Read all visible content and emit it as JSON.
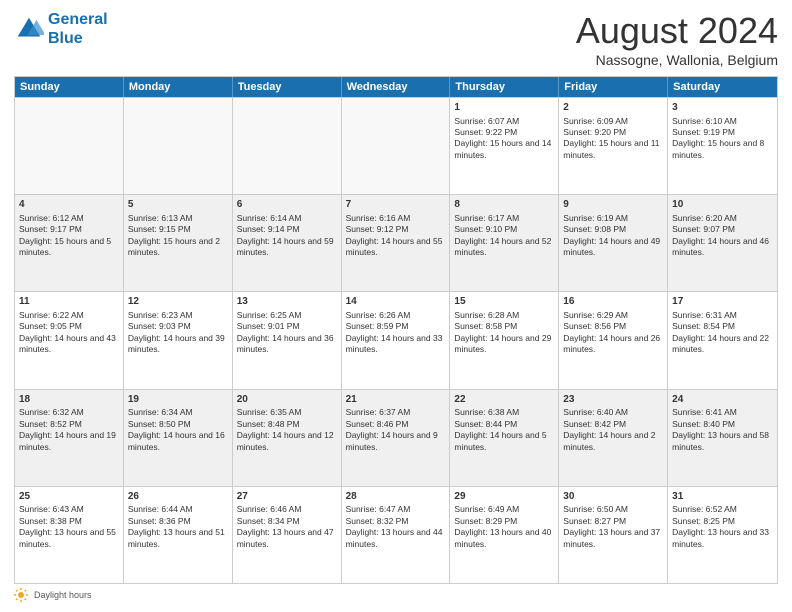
{
  "header": {
    "logo_line1": "General",
    "logo_line2": "Blue",
    "month_title": "August 2024",
    "subtitle": "Nassogne, Wallonia, Belgium"
  },
  "weekdays": [
    "Sunday",
    "Monday",
    "Tuesday",
    "Wednesday",
    "Thursday",
    "Friday",
    "Saturday"
  ],
  "footer": {
    "note": "Daylight hours"
  },
  "weeks": [
    [
      {
        "day": "",
        "empty": true
      },
      {
        "day": "",
        "empty": true
      },
      {
        "day": "",
        "empty": true
      },
      {
        "day": "",
        "empty": true
      },
      {
        "day": "1",
        "rise": "Sunrise: 6:07 AM",
        "set": "Sunset: 9:22 PM",
        "daylight": "Daylight: 15 hours and 14 minutes."
      },
      {
        "day": "2",
        "rise": "Sunrise: 6:09 AM",
        "set": "Sunset: 9:20 PM",
        "daylight": "Daylight: 15 hours and 11 minutes."
      },
      {
        "day": "3",
        "rise": "Sunrise: 6:10 AM",
        "set": "Sunset: 9:19 PM",
        "daylight": "Daylight: 15 hours and 8 minutes."
      }
    ],
    [
      {
        "day": "4",
        "rise": "Sunrise: 6:12 AM",
        "set": "Sunset: 9:17 PM",
        "daylight": "Daylight: 15 hours and 5 minutes.",
        "shaded": true
      },
      {
        "day": "5",
        "rise": "Sunrise: 6:13 AM",
        "set": "Sunset: 9:15 PM",
        "daylight": "Daylight: 15 hours and 2 minutes.",
        "shaded": true
      },
      {
        "day": "6",
        "rise": "Sunrise: 6:14 AM",
        "set": "Sunset: 9:14 PM",
        "daylight": "Daylight: 14 hours and 59 minutes.",
        "shaded": true
      },
      {
        "day": "7",
        "rise": "Sunrise: 6:16 AM",
        "set": "Sunset: 9:12 PM",
        "daylight": "Daylight: 14 hours and 55 minutes.",
        "shaded": true
      },
      {
        "day": "8",
        "rise": "Sunrise: 6:17 AM",
        "set": "Sunset: 9:10 PM",
        "daylight": "Daylight: 14 hours and 52 minutes.",
        "shaded": true
      },
      {
        "day": "9",
        "rise": "Sunrise: 6:19 AM",
        "set": "Sunset: 9:08 PM",
        "daylight": "Daylight: 14 hours and 49 minutes.",
        "shaded": true
      },
      {
        "day": "10",
        "rise": "Sunrise: 6:20 AM",
        "set": "Sunset: 9:07 PM",
        "daylight": "Daylight: 14 hours and 46 minutes.",
        "shaded": true
      }
    ],
    [
      {
        "day": "11",
        "rise": "Sunrise: 6:22 AM",
        "set": "Sunset: 9:05 PM",
        "daylight": "Daylight: 14 hours and 43 minutes."
      },
      {
        "day": "12",
        "rise": "Sunrise: 6:23 AM",
        "set": "Sunset: 9:03 PM",
        "daylight": "Daylight: 14 hours and 39 minutes."
      },
      {
        "day": "13",
        "rise": "Sunrise: 6:25 AM",
        "set": "Sunset: 9:01 PM",
        "daylight": "Daylight: 14 hours and 36 minutes."
      },
      {
        "day": "14",
        "rise": "Sunrise: 6:26 AM",
        "set": "Sunset: 8:59 PM",
        "daylight": "Daylight: 14 hours and 33 minutes."
      },
      {
        "day": "15",
        "rise": "Sunrise: 6:28 AM",
        "set": "Sunset: 8:58 PM",
        "daylight": "Daylight: 14 hours and 29 minutes."
      },
      {
        "day": "16",
        "rise": "Sunrise: 6:29 AM",
        "set": "Sunset: 8:56 PM",
        "daylight": "Daylight: 14 hours and 26 minutes."
      },
      {
        "day": "17",
        "rise": "Sunrise: 6:31 AM",
        "set": "Sunset: 8:54 PM",
        "daylight": "Daylight: 14 hours and 22 minutes."
      }
    ],
    [
      {
        "day": "18",
        "rise": "Sunrise: 6:32 AM",
        "set": "Sunset: 8:52 PM",
        "daylight": "Daylight: 14 hours and 19 minutes.",
        "shaded": true
      },
      {
        "day": "19",
        "rise": "Sunrise: 6:34 AM",
        "set": "Sunset: 8:50 PM",
        "daylight": "Daylight: 14 hours and 16 minutes.",
        "shaded": true
      },
      {
        "day": "20",
        "rise": "Sunrise: 6:35 AM",
        "set": "Sunset: 8:48 PM",
        "daylight": "Daylight: 14 hours and 12 minutes.",
        "shaded": true
      },
      {
        "day": "21",
        "rise": "Sunrise: 6:37 AM",
        "set": "Sunset: 8:46 PM",
        "daylight": "Daylight: 14 hours and 9 minutes.",
        "shaded": true
      },
      {
        "day": "22",
        "rise": "Sunrise: 6:38 AM",
        "set": "Sunset: 8:44 PM",
        "daylight": "Daylight: 14 hours and 5 minutes.",
        "shaded": true
      },
      {
        "day": "23",
        "rise": "Sunrise: 6:40 AM",
        "set": "Sunset: 8:42 PM",
        "daylight": "Daylight: 14 hours and 2 minutes.",
        "shaded": true
      },
      {
        "day": "24",
        "rise": "Sunrise: 6:41 AM",
        "set": "Sunset: 8:40 PM",
        "daylight": "Daylight: 13 hours and 58 minutes.",
        "shaded": true
      }
    ],
    [
      {
        "day": "25",
        "rise": "Sunrise: 6:43 AM",
        "set": "Sunset: 8:38 PM",
        "daylight": "Daylight: 13 hours and 55 minutes."
      },
      {
        "day": "26",
        "rise": "Sunrise: 6:44 AM",
        "set": "Sunset: 8:36 PM",
        "daylight": "Daylight: 13 hours and 51 minutes."
      },
      {
        "day": "27",
        "rise": "Sunrise: 6:46 AM",
        "set": "Sunset: 8:34 PM",
        "daylight": "Daylight: 13 hours and 47 minutes."
      },
      {
        "day": "28",
        "rise": "Sunrise: 6:47 AM",
        "set": "Sunset: 8:32 PM",
        "daylight": "Daylight: 13 hours and 44 minutes."
      },
      {
        "day": "29",
        "rise": "Sunrise: 6:49 AM",
        "set": "Sunset: 8:29 PM",
        "daylight": "Daylight: 13 hours and 40 minutes."
      },
      {
        "day": "30",
        "rise": "Sunrise: 6:50 AM",
        "set": "Sunset: 8:27 PM",
        "daylight": "Daylight: 13 hours and 37 minutes."
      },
      {
        "day": "31",
        "rise": "Sunrise: 6:52 AM",
        "set": "Sunset: 8:25 PM",
        "daylight": "Daylight: 13 hours and 33 minutes."
      }
    ]
  ]
}
